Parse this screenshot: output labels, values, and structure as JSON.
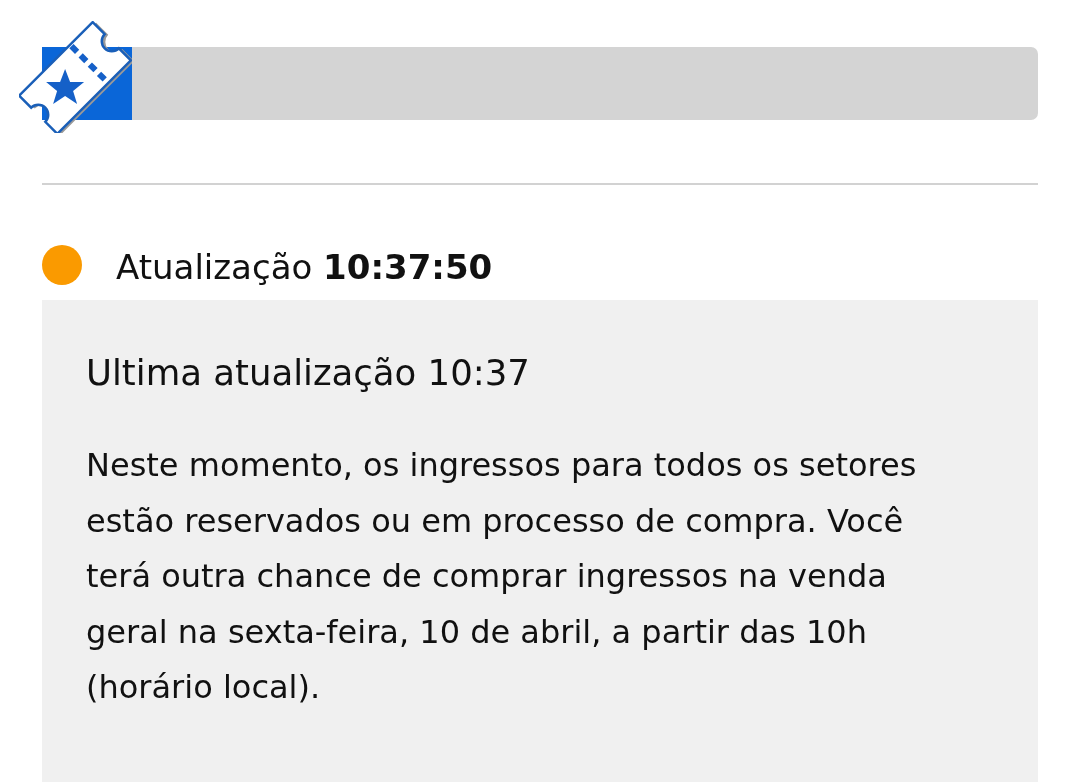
{
  "status": {
    "text": "Atualização **10:37:50**"
  },
  "notice": {
    "title": "Ultima atualização 10:37",
    "body": "Neste momento, os ingressos para todos os setores estão reservados ou em processo de compra. Você terá outra chance de comprar ingressos na venda geral na sexta-feira, 10 de abril, a partir das 10h (horário local)."
  }
}
